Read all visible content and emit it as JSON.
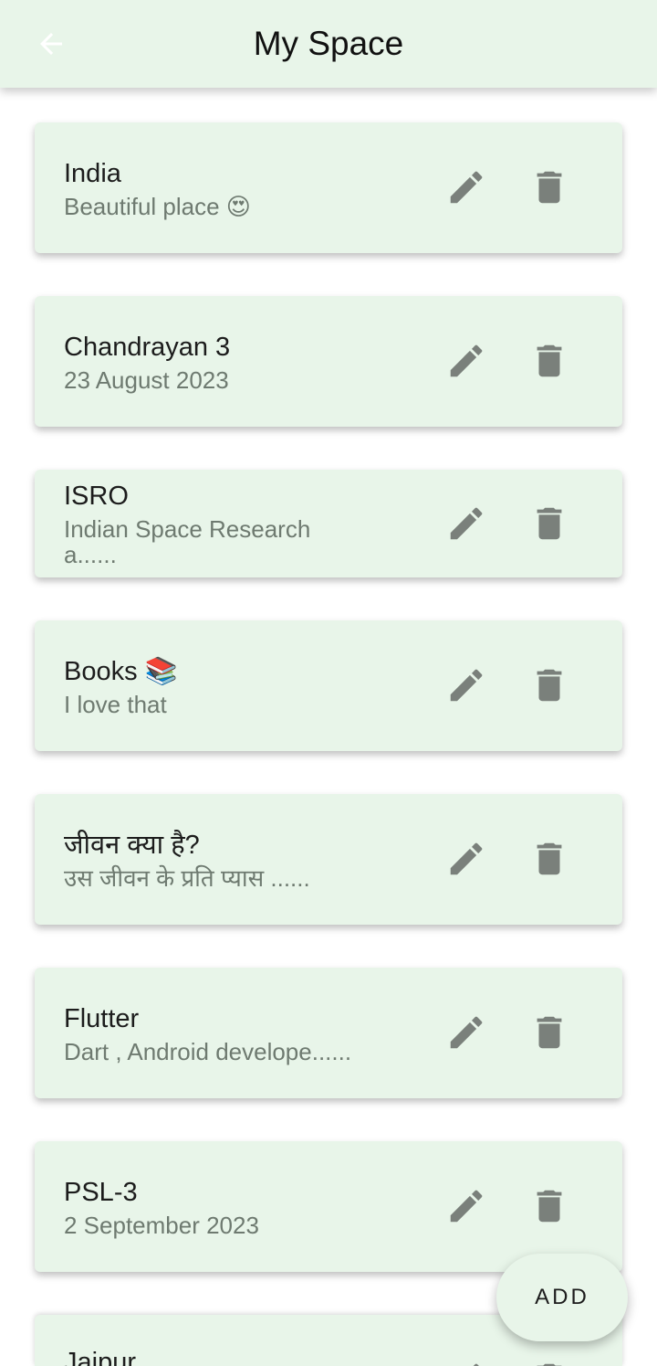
{
  "appbar": {
    "title": "My Space",
    "back_icon": "arrow-back-icon"
  },
  "notes": [
    {
      "title": "India",
      "subtitle": "Beautiful place 😍"
    },
    {
      "title": "Chandrayan 3",
      "subtitle": "23 August 2023"
    },
    {
      "title": "ISRO",
      "subtitle": "Indian Space Research a......"
    },
    {
      "title": "Books 📚",
      "subtitle": "I love that"
    },
    {
      "title": "जीवन क्या है?",
      "subtitle": "उस जीवन के प्रति प्यास ......"
    },
    {
      "title": "Flutter",
      "subtitle": "Dart , Android develope......"
    },
    {
      "title": "PSL-3",
      "subtitle": "2 September 2023"
    },
    {
      "title": "Jaipur",
      "subtitle": ""
    }
  ],
  "actions": {
    "edit_icon": "pencil-icon",
    "delete_icon": "trash-icon"
  },
  "fab": {
    "label": "ADD"
  },
  "colors": {
    "card_bg": "#e8f5e9",
    "appbar_bg": "#e8f5e9",
    "icon": "#7a807b"
  }
}
